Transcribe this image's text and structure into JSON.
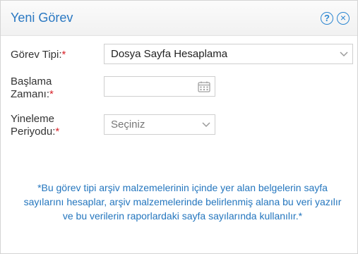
{
  "dialog": {
    "title": "Yeni Görev",
    "help_icon": "question-circle-icon",
    "close_icon": "close-circle-icon"
  },
  "form": {
    "task_type": {
      "label": "Görev Tipi:",
      "required_mark": "*",
      "value": "Dosya Sayfa Hesaplama"
    },
    "start_time": {
      "label_line1": "Başlama",
      "label_line2": "Zamanı:",
      "required_mark": "*",
      "value": "",
      "icon": "calendar-icon"
    },
    "repeat_period": {
      "label_line1": "Yineleme",
      "label_line2": "Periyodu:",
      "required_mark": "*",
      "value": "Seçiniz"
    }
  },
  "info_text": "*Bu görev tipi arşiv malzemelerinin içinde yer alan belgelerin sayfa sayılarını hesaplar, arşiv malzemelerinde belirlenmiş alana bu veri yazılır ve bu verilerin raporlardaki sayfa sayılarında kullanılır.*",
  "colors": {
    "title": "#2a78c2",
    "accent_icon": "#2b86d1",
    "required": "#d8232a",
    "info": "#2476be"
  }
}
